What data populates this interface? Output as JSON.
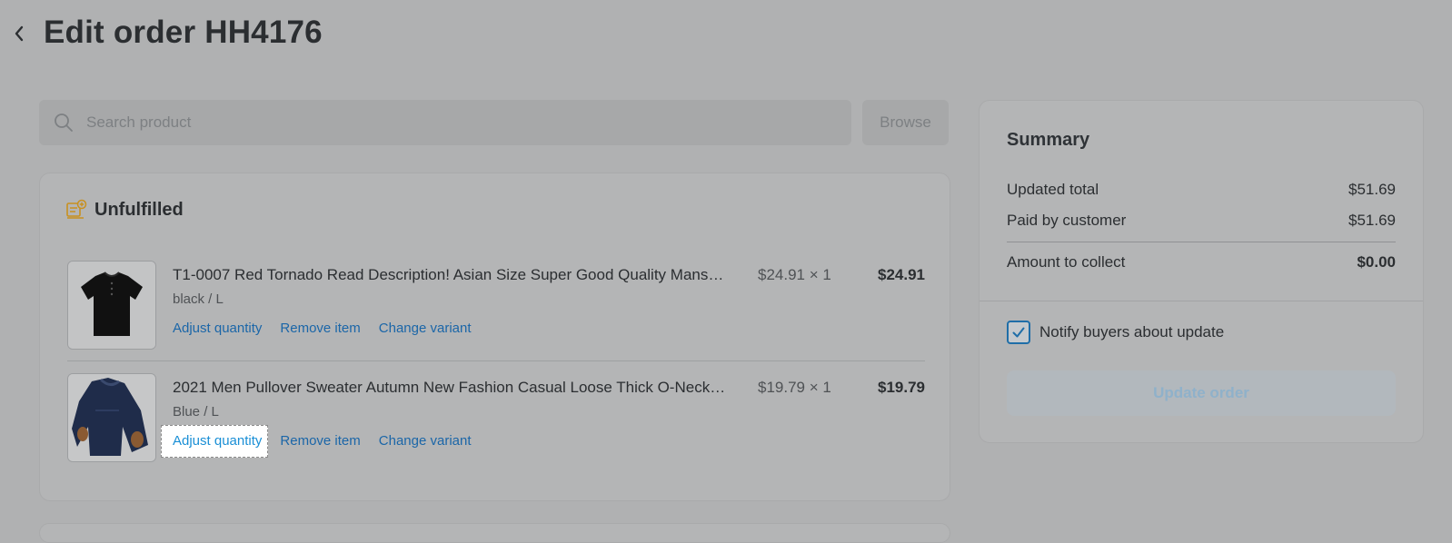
{
  "header": {
    "title": "Edit order HH4176"
  },
  "search": {
    "placeholder": "Search product",
    "browse_label": "Browse"
  },
  "section": {
    "title": "Unfulfilled"
  },
  "items": [
    {
      "name": "T1-0007 Red Tornado Read Description! Asian Size Super Good Quality Mans…",
      "variant": "black / L",
      "unit_qty": "$24.91 × 1",
      "total": "$24.91",
      "actions": {
        "adjust": "Adjust quantity",
        "remove": "Remove item",
        "change": "Change variant"
      }
    },
    {
      "name": "2021 Men Pullover Sweater Autumn New Fashion Casual Loose Thick O-Neck…",
      "variant": "Blue / L",
      "unit_qty": "$19.79 × 1",
      "total": "$19.79",
      "actions": {
        "adjust": "Adjust quantity",
        "remove": "Remove item",
        "change": "Change variant"
      }
    }
  ],
  "summary": {
    "title": "Summary",
    "updated_total_label": "Updated total",
    "updated_total": "$51.69",
    "paid_label": "Paid by customer",
    "paid": "$51.69",
    "collect_label": "Amount to collect",
    "collect": "$0.00",
    "notify_label": "Notify buyers about update",
    "notify_checked": true,
    "update_label": "Update order"
  },
  "colors": {
    "link": "#1b66a8",
    "accent_icon": "#c8901f",
    "checkbox": "#1f6ea8"
  }
}
